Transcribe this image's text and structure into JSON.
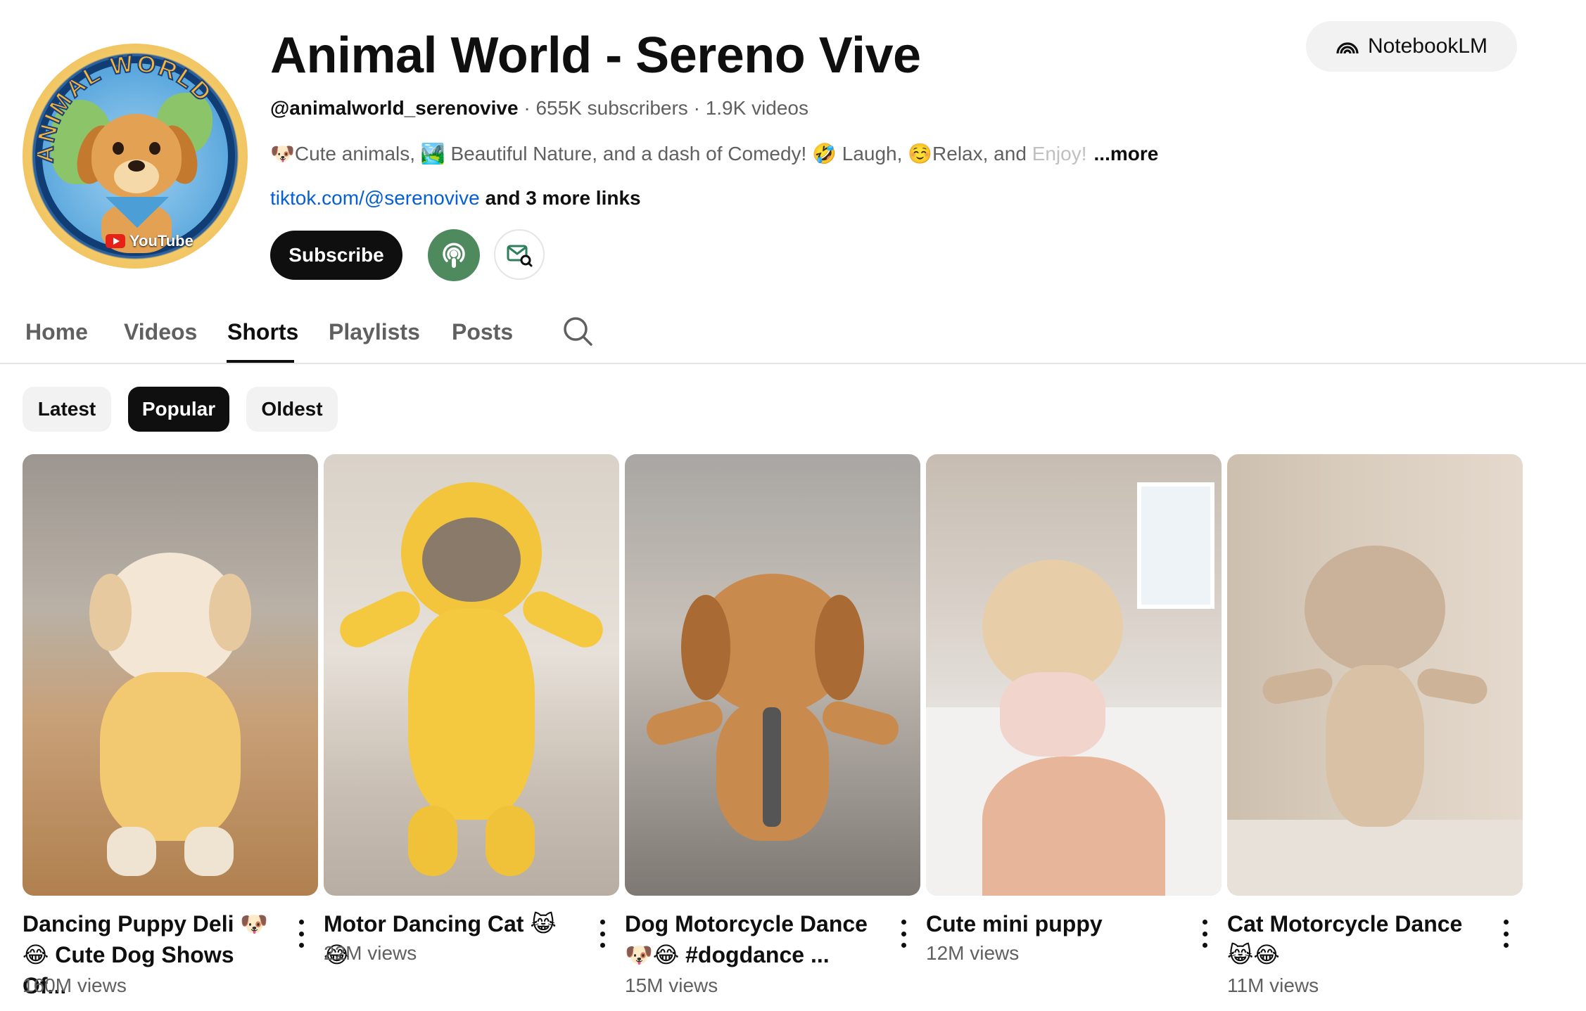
{
  "channel": {
    "title": "Animal World - Sereno Vive",
    "handle": "@animalworld_serenovive",
    "subscribers": "655K subscribers",
    "videos": "1.9K videos",
    "separator": " · ",
    "description": "🐶Cute animals, 🏞️ Beautiful Nature, and a dash of Comedy! 🤣 Laugh, ☺️Relax, and ",
    "description_faded": "Enjoy!",
    "more_label": "...more",
    "link_text": "tiktok.com/@serenovive",
    "more_links": "and 3 more links",
    "avatar_arc_text": "ANIMAL WORLD",
    "avatar_badge": "YouTube"
  },
  "actions": {
    "subscribe_label": "Subscribe",
    "notebook_label": "NotebookLM"
  },
  "tabs": [
    {
      "label": "Home"
    },
    {
      "label": "Videos"
    },
    {
      "label": "Shorts",
      "active": true
    },
    {
      "label": "Playlists"
    },
    {
      "label": "Posts"
    }
  ],
  "chips": [
    {
      "label": "Latest"
    },
    {
      "label": "Popular",
      "active": true
    },
    {
      "label": "Oldest"
    }
  ],
  "shorts": [
    {
      "title_line1": "Dancing Puppy Deli 🐶",
      "title_line2": "😂 Cute Dog Shows Of...",
      "views": "160M views"
    },
    {
      "title_line1": "Motor Dancing Cat 😹😂",
      "title_line2": "",
      "views": "22M views"
    },
    {
      "title_line1": "Dog Motorcycle Dance",
      "title_line2": "🐶😂 #dogdance ...",
      "views": "15M views"
    },
    {
      "title_line1": "Cute mini puppy",
      "title_line2": "",
      "views": "12M views"
    },
    {
      "title_line1": "Cat Motorcycle Dance",
      "title_line2": "😹😂",
      "views": "11M views"
    }
  ],
  "colors": {
    "text_primary": "#0f0f0f",
    "text_secondary": "#606060",
    "link": "#065fd4",
    "chip_bg": "#f2f2f2",
    "podcast_green": "#4f8a5f"
  },
  "icons": {
    "search": "search-icon",
    "podcast": "podcast-icon",
    "mail": "mail-search-icon",
    "notebook": "notebooklm-icon",
    "menu": "more-vert-icon"
  }
}
